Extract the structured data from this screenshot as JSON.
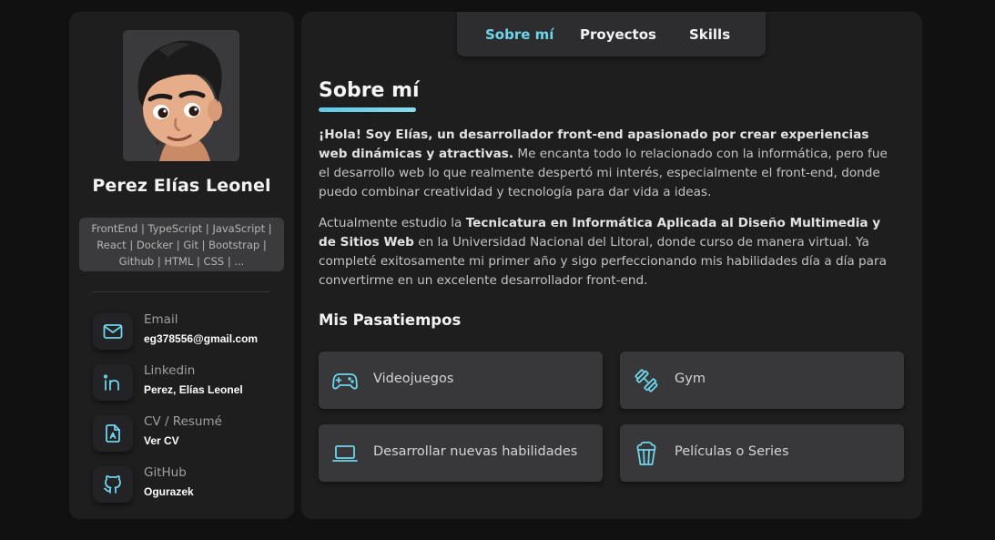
{
  "profile": {
    "name": "Perez Elías Leonel",
    "skills": "FrontEnd | TypeScript | JavaScript | React | Docker | Git | Bootstrap | Github | HTML | CSS | ..."
  },
  "contacts": [
    {
      "label": "Email",
      "value": "eg378556@gmail.com",
      "icon": "mail-icon"
    },
    {
      "label": "Linkedin",
      "value": "Perez, Elías Leonel",
      "icon": "linkedin-icon"
    },
    {
      "label": "CV / Resumé",
      "value": "Ver CV",
      "icon": "document-icon"
    },
    {
      "label": "GitHub",
      "value": "Ogurazek",
      "icon": "github-icon"
    }
  ],
  "nav": {
    "tabs": [
      "Sobre mí",
      "Proyectos",
      "Skills"
    ],
    "active": "Sobre mí"
  },
  "about": {
    "title": "Sobre mí",
    "p1_bold": "¡Hola! Soy Elías, un desarrollador front-end apasionado por crear experiencias web dinámicas y atractivas.",
    "p1_rest": " Me encanta todo lo relacionado con la informática, pero fue el desarrollo web lo que realmente despertó mi interés, especialmente el front-end, donde puedo combinar creatividad y tecnología para dar vida a ideas.",
    "p2_a": "Actualmente estudio la ",
    "p2_bold": "Tecnicatura en Informática Aplicada al Diseño Multimedia y de Sitios Web",
    "p2_b": " en la Universidad Nacional del Litoral, donde curso de manera virtual. Ya completé exitosamente mi primer año y sigo perfeccionando mis habilidades día a día para convertirme en un excelente desarrollador front-end."
  },
  "hobbies": {
    "title": "Mis Pasatiempos",
    "items": [
      {
        "label": "Videojuegos",
        "icon": "gamepad-icon"
      },
      {
        "label": "Gym",
        "icon": "dumbbell-icon"
      },
      {
        "label": "Desarrollar nuevas habilidades",
        "icon": "laptop-icon"
      },
      {
        "label": "Películas o Series",
        "icon": "popcorn-icon"
      }
    ]
  },
  "colors": {
    "accent": "#6ed4ea",
    "background": "#111111",
    "panel": "#1e1e1f",
    "card": "#38383a"
  }
}
